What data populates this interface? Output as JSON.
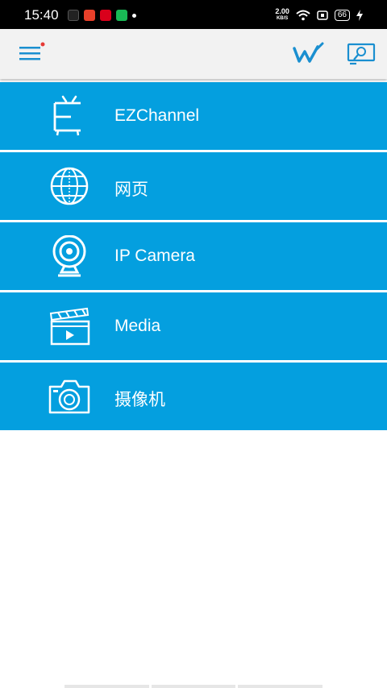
{
  "status_bar": {
    "time": "15:40",
    "net_speed": "2.00",
    "net_unit": "KB/S",
    "battery": "66"
  },
  "header": {
    "menu_icon": "hamburger-menu-icon",
    "w_icon": "w-logo-icon",
    "cast_icon": "screen-cast-icon",
    "accent": "#1a8fd0"
  },
  "menu": {
    "items": [
      {
        "label": "EZChannel",
        "icon": "tv-icon"
      },
      {
        "label": "网页",
        "icon": "globe-icon"
      },
      {
        "label": "IP Camera",
        "icon": "webcam-icon"
      },
      {
        "label": "Media",
        "icon": "clapperboard-icon"
      },
      {
        "label": "摄像机",
        "icon": "camera-icon"
      }
    ],
    "row_color": "#049fdf"
  }
}
